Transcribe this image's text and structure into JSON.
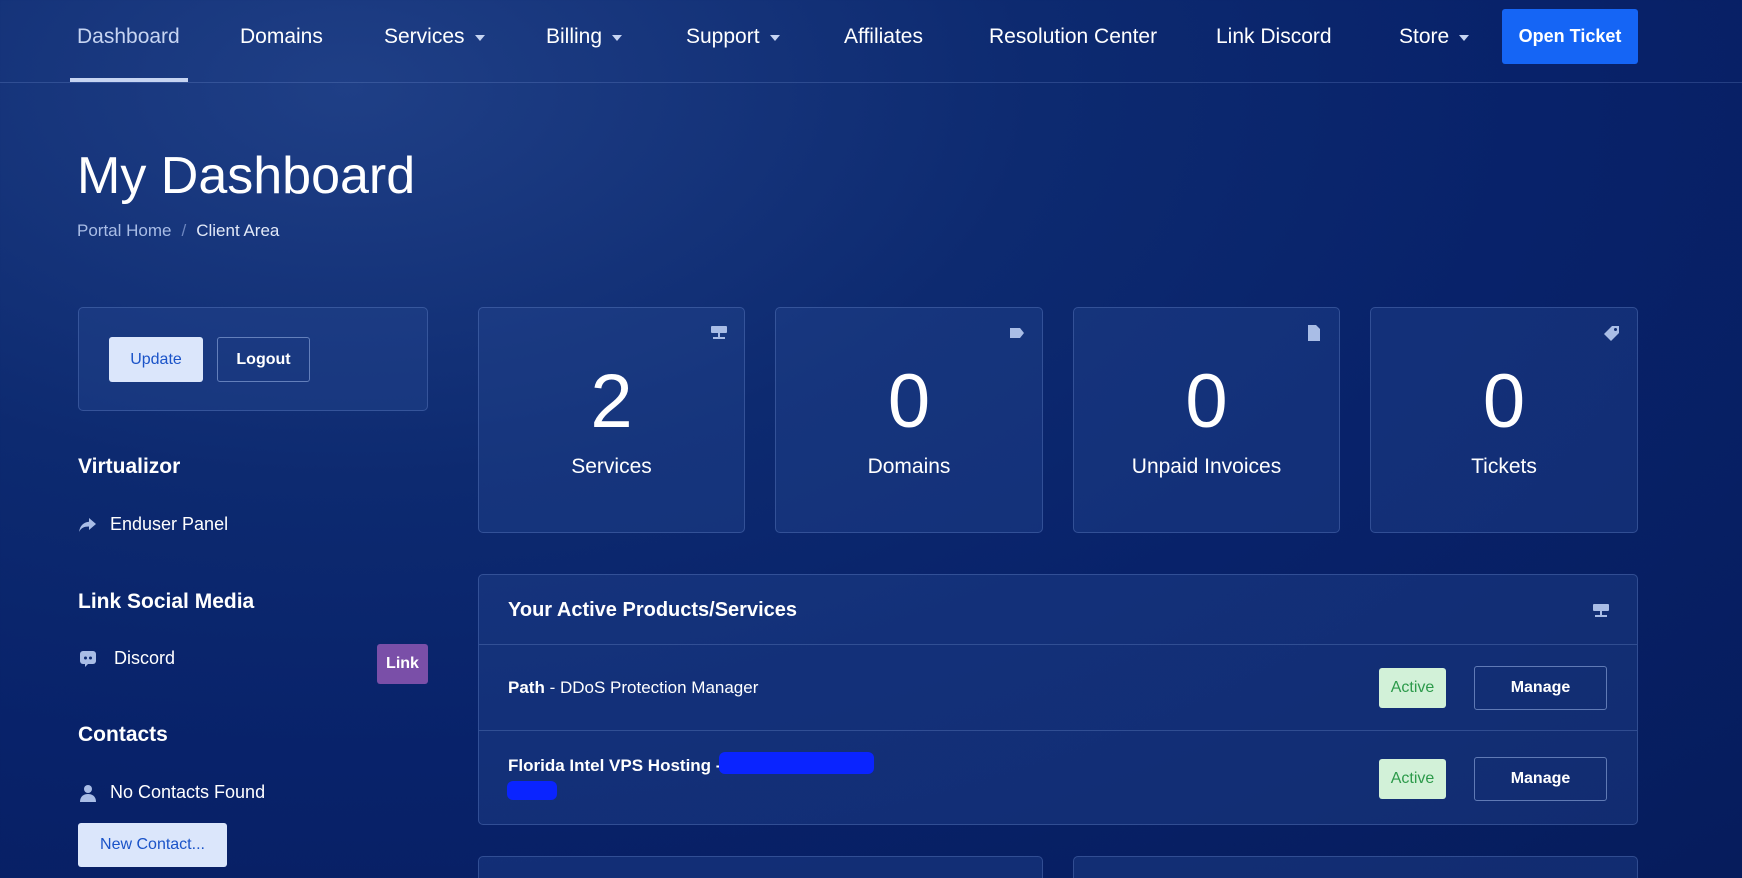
{
  "nav": {
    "items": [
      {
        "label": "Dashboard",
        "has_caret": false,
        "active": true
      },
      {
        "label": "Domains",
        "has_caret": false
      },
      {
        "label": "Services",
        "has_caret": true
      },
      {
        "label": "Billing",
        "has_caret": true
      },
      {
        "label": "Support",
        "has_caret": true
      },
      {
        "label": "Affiliates",
        "has_caret": false
      },
      {
        "label": "Resolution Center",
        "has_caret": false
      },
      {
        "label": "Link Discord",
        "has_caret": false
      },
      {
        "label": "Store",
        "has_caret": true
      }
    ],
    "cta_label": "Open Ticket"
  },
  "header": {
    "title": "My Dashboard",
    "breadcrumb": [
      {
        "label": "Portal Home",
        "link": true
      },
      {
        "label": "Client Area",
        "link": false
      }
    ],
    "separator": "/"
  },
  "sidebar": {
    "account": {
      "update_label": "Update",
      "logout_label": "Logout"
    },
    "virtualizor": {
      "heading": "Virtualizor",
      "item_label": "Enduser Panel",
      "item_icon": "share-arrow-icon"
    },
    "social": {
      "heading": "Link Social Media",
      "item_label": "Discord",
      "item_icon": "discord-icon",
      "link_label": "Link"
    },
    "contacts": {
      "heading": "Contacts",
      "empty_label": "No Contacts Found",
      "empty_icon": "user-icon",
      "new_label": "New Contact..."
    }
  },
  "stats": [
    {
      "value": "2",
      "label": "Services",
      "icon": "server-icon"
    },
    {
      "value": "0",
      "label": "Domains",
      "icon": "tag-icon"
    },
    {
      "value": "0",
      "label": "Unpaid Invoices",
      "icon": "document-icon"
    },
    {
      "value": "0",
      "label": "Tickets",
      "icon": "ticket-tag-icon"
    }
  ],
  "products": {
    "title": "Your Active Products/Services",
    "icon": "server-icon",
    "rows": [
      {
        "name": "Path",
        "suffix": " - DDoS Protection Manager",
        "status": "Active",
        "action": "Manage"
      },
      {
        "name": "Florida Intel VPS Hosting -",
        "suffix": "",
        "status": "Active",
        "action": "Manage"
      }
    ]
  },
  "colors": {
    "accent": "#1565f5",
    "link_button": "#7a4fa8",
    "active_badge_bg": "#d2f1d8",
    "active_badge_text": "#2c9a4a",
    "redaction": "#0a24ff"
  }
}
